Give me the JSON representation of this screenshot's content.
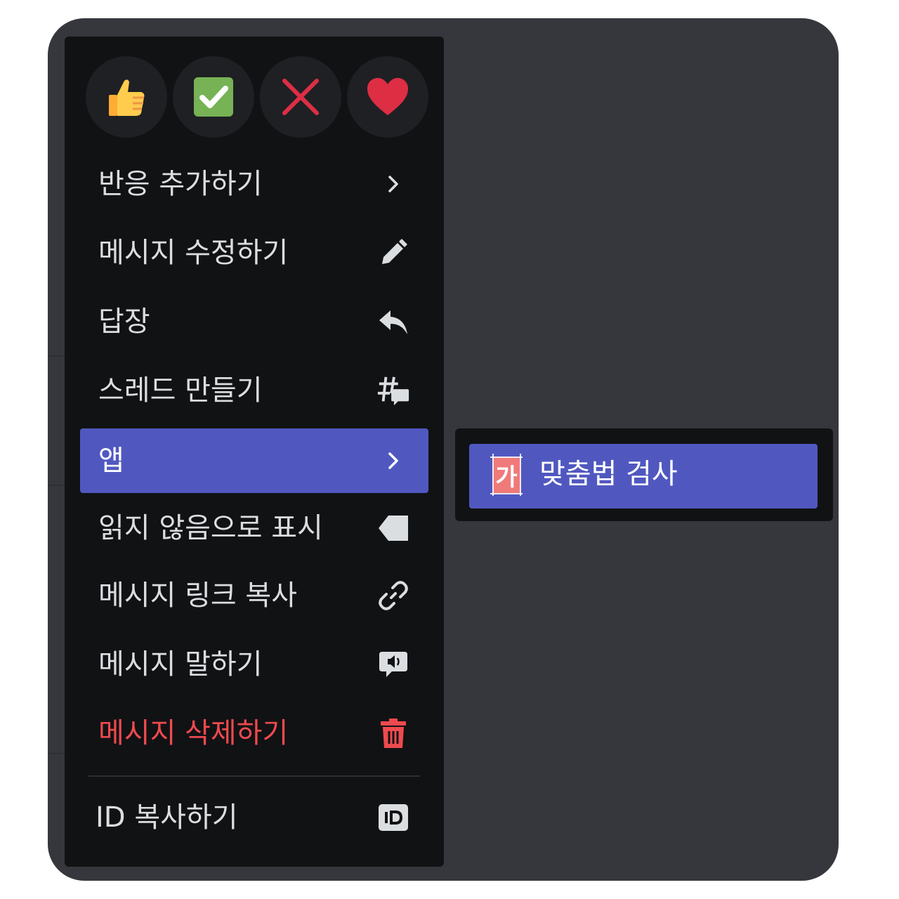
{
  "reactions": [
    {
      "emoji": "👍",
      "icon": "thumbs-up-icon"
    },
    {
      "emoji": "✅",
      "icon": "check-mark-icon"
    },
    {
      "emoji": "❌",
      "icon": "cross-mark-icon"
    },
    {
      "emoji": "❤️",
      "icon": "heart-icon"
    }
  ],
  "menu": {
    "add_reaction": "반응 추가하기",
    "edit_message": "메시지 수정하기",
    "reply": "답장",
    "create_thread": "스레드 만들기",
    "apps": "앱",
    "mark_unread": "읽지 않음으로 표시",
    "copy_message_link": "메시지 링크 복사",
    "speak_message": "메시지 말하기",
    "delete_message": "메시지 삭제하기",
    "copy_id": "ID 복사하기"
  },
  "submenu": {
    "spellcheck_icon_text": "가",
    "spellcheck": "맞춤법 검사"
  },
  "colors": {
    "menu_bg": "#111214",
    "highlight": "#5058c0",
    "danger": "#ee4a4f",
    "text": "#dbdee1"
  }
}
